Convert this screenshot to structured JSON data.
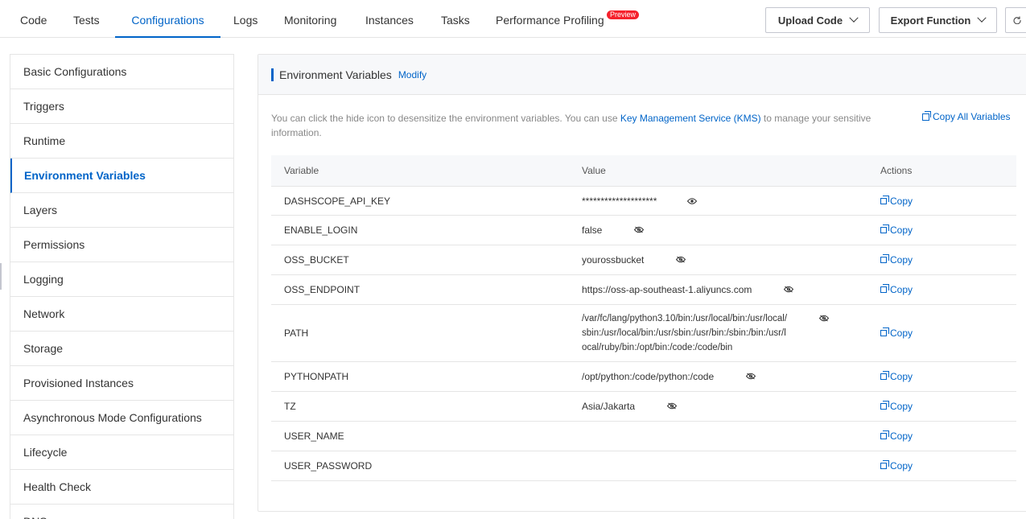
{
  "tabs": [
    {
      "label": "Code"
    },
    {
      "label": "Tests"
    },
    {
      "label": "Configurations"
    },
    {
      "label": "Logs"
    },
    {
      "label": "Monitoring"
    },
    {
      "label": "Instances"
    },
    {
      "label": "Tasks"
    },
    {
      "label": "Performance Profiling"
    }
  ],
  "preview_badge": "Preview",
  "buttons": {
    "upload": "Upload Code",
    "export": "Export Function"
  },
  "sidebar": {
    "items": [
      {
        "label": "Basic Configurations"
      },
      {
        "label": "Triggers"
      },
      {
        "label": "Runtime"
      },
      {
        "label": "Environment Variables"
      },
      {
        "label": "Layers"
      },
      {
        "label": "Permissions"
      },
      {
        "label": "Logging"
      },
      {
        "label": "Network"
      },
      {
        "label": "Storage"
      },
      {
        "label": "Provisioned Instances"
      },
      {
        "label": "Asynchronous Mode Configurations"
      },
      {
        "label": "Lifecycle"
      },
      {
        "label": "Health Check"
      },
      {
        "label": "DNS"
      }
    ]
  },
  "panel": {
    "title": "Environment Variables",
    "modify": "Modify",
    "desc_before": "You can click the hide icon to desensitize the environment variables. You can use ",
    "desc_link": "Key Management Service (KMS)",
    "desc_after": " to manage your sensitive information.",
    "copy_all": "Copy All Variables"
  },
  "table": {
    "headers": {
      "variable": "Variable",
      "value": "Value",
      "actions": "Actions"
    },
    "copy_label": "Copy",
    "rows": [
      {
        "name": "DASHSCOPE_API_KEY",
        "value": "********************"
      },
      {
        "name": "ENABLE_LOGIN",
        "value": "false"
      },
      {
        "name": "OSS_BUCKET",
        "value": "yourossbucket"
      },
      {
        "name": "OSS_ENDPOINT",
        "value": "https://oss-ap-southeast-1.aliyuncs.com"
      },
      {
        "name": "PATH",
        "value": "/var/fc/lang/python3.10/bin:/usr/local/bin:/usr/local/\nsbin:/usr/local/bin:/usr/sbin:/usr/bin:/sbin:/bin:/usr/l\nocal/ruby/bin:/opt/bin:/code:/code/bin"
      },
      {
        "name": "PYTHONPATH",
        "value": "/opt/python:/code/python:/code"
      },
      {
        "name": "TZ",
        "value": "Asia/Jakarta"
      },
      {
        "name": "USER_NAME",
        "value": ""
      },
      {
        "name": "USER_PASSWORD",
        "value": ""
      }
    ]
  }
}
